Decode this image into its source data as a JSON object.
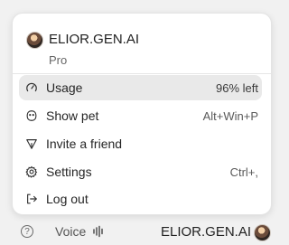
{
  "account": {
    "name": "ELIOR.GEN.AI",
    "plan": "Pro"
  },
  "menu": {
    "items": [
      {
        "id": "usage",
        "label": "Usage",
        "trailing": "96% left",
        "icon": "gauge-icon"
      },
      {
        "id": "show-pet",
        "label": "Show pet",
        "trailing": "Alt+Win+P",
        "icon": "pet-icon"
      },
      {
        "id": "invite",
        "label": "Invite a friend",
        "trailing": "",
        "icon": "send-icon"
      },
      {
        "id": "settings",
        "label": "Settings",
        "trailing": "Ctrl+,",
        "icon": "gear-icon"
      },
      {
        "id": "logout",
        "label": "Log out",
        "trailing": "",
        "icon": "logout-icon"
      }
    ]
  },
  "footer": {
    "voice_label": "Voice",
    "name": "ELIOR.GEN.AI"
  }
}
